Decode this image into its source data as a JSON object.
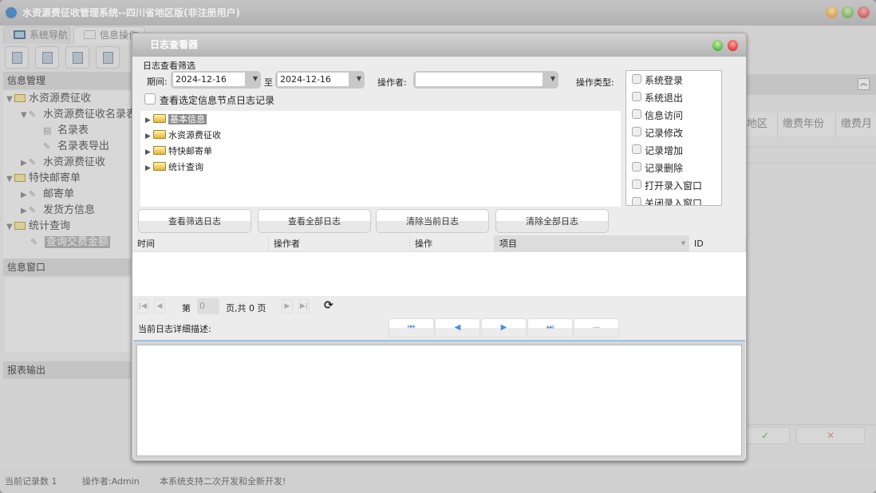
{
  "app": {
    "title": "水资源费征收管理系统--四川省地区版(非注册用户)",
    "tabs": [
      {
        "label": "系统导航"
      },
      {
        "label": "信息操作"
      }
    ],
    "left_panel": {
      "header": "信息管理",
      "tree": [
        {
          "label": "水资源费征收"
        },
        {
          "label": "水资源费征收名录表"
        },
        {
          "label": "名录表"
        },
        {
          "label": "名录表导出"
        },
        {
          "label": "水资源费征收"
        },
        {
          "label": "特快邮寄单"
        },
        {
          "label": "邮寄单"
        },
        {
          "label": "发货方信息"
        },
        {
          "label": "统计查询"
        },
        {
          "label": "查询交费金额"
        }
      ],
      "info_window": "信息窗口",
      "report_output": "报表输出"
    },
    "grid_columns": [
      "地区",
      "缴费年份",
      "缴费月"
    ],
    "bottom_buttons": {
      "ok": "✓",
      "cancel": "✕"
    },
    "status": {
      "record_count": "当前记录数 1",
      "operator": "操作者:Admin",
      "message": "本系统支持二次开发和全新开发!"
    }
  },
  "dialog": {
    "title": "日志查看器",
    "filter_title": "日志查看筛选",
    "period_label": "期间:",
    "date_from": "2024-12-16",
    "to_label": "至",
    "date_to": "2024-12-16",
    "operator_label": "操作者:",
    "operator_value": "",
    "type_label": "操作类型:",
    "node_checkbox_label": "查看选定信息节点日志记录",
    "tree": [
      {
        "label": "基本信息"
      },
      {
        "label": "水资源费征收"
      },
      {
        "label": "特快邮寄单"
      },
      {
        "label": "统计查询"
      }
    ],
    "types": [
      "系统登录",
      "系统退出",
      "信息访问",
      "记录修改",
      "记录增加",
      "记录删除",
      "打开录入窗口",
      "关闭录入窗口"
    ],
    "actions": [
      "查看筛选日志",
      "查看全部日志",
      "清除当前日志",
      "清除全部日志"
    ],
    "columns": [
      "时间",
      "操作者",
      "操作",
      "项目",
      "ID"
    ],
    "pager": {
      "page_prefix": "第",
      "page_value": "0",
      "page_suffix": "页,共 0 页"
    },
    "detail_label": "当前日志详细描述:",
    "nav_buttons": [
      "⏮",
      "◀",
      "▶",
      "⏭",
      "—"
    ]
  }
}
